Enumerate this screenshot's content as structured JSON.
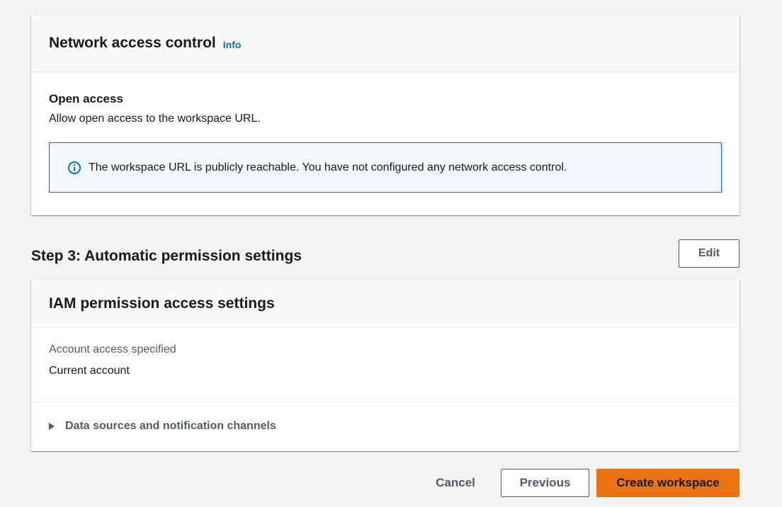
{
  "network_card": {
    "title": "Network access control",
    "info_label": "Info",
    "open_access_title": "Open access",
    "open_access_description": "Allow open access to the workspace URL.",
    "alert": {
      "icon": "info-circle-icon",
      "text": "The workspace URL is publicly reachable. You have not configured any network access control."
    }
  },
  "step3": {
    "title": "Step 3: Automatic permission settings",
    "edit_label": "Edit"
  },
  "iam_card": {
    "title": "IAM permission access settings",
    "account_access_label": "Account access specified",
    "account_access_value": "Current account",
    "expander": {
      "icon": "caret-right-icon",
      "label": "Data sources and notification channels"
    }
  },
  "actions": {
    "cancel_label": "Cancel",
    "previous_label": "Previous",
    "create_label": "Create workspace"
  },
  "colors": {
    "background": "#f2f3f3",
    "card": "#ffffff",
    "card_header": "#fafafa",
    "link": "#0073bb",
    "alert_border": "#0073bb",
    "alert_background": "#f1faff",
    "primary_button": "#ec7211",
    "secondary_text": "#545b64",
    "text": "#16191f"
  }
}
